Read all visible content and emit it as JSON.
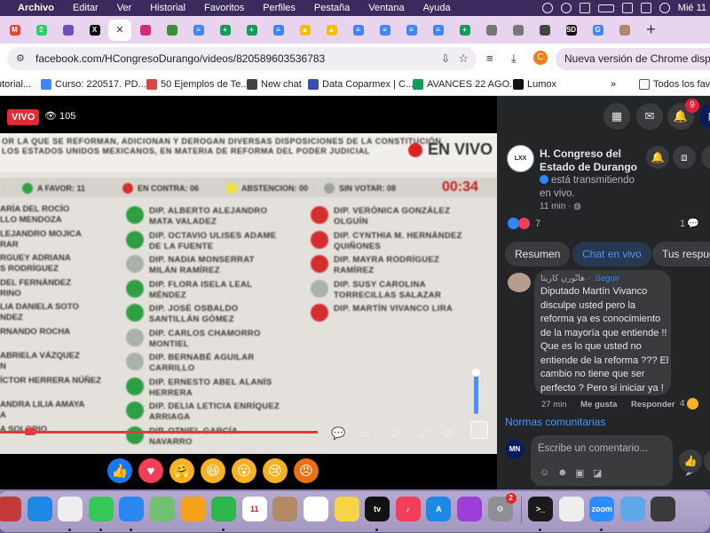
{
  "menubar": {
    "items": [
      "Archivo",
      "Editar",
      "Ver",
      "Historial",
      "Favoritos",
      "Perfiles",
      "Pestaña",
      "Ventana",
      "Ayuda"
    ],
    "clock": "Mié 11"
  },
  "tabs": [
    {
      "icon": "gmail-icon",
      "color": "#ea4335",
      "glyph": "M"
    },
    {
      "icon": "whatsapp-icon",
      "color": "#25d366",
      "glyph": "2"
    },
    {
      "icon": "extension-icon",
      "color": "#6b4fbb",
      "glyph": ""
    },
    {
      "icon": "x-icon",
      "color": "#000000",
      "glyph": "X"
    },
    {
      "icon": "close-tab-icon",
      "color": "#ffffff",
      "glyph": "✕"
    },
    {
      "icon": "instagram-icon",
      "color": "#d62976",
      "glyph": ""
    },
    {
      "icon": "globe-icon",
      "color": "#3c8d3c",
      "glyph": ""
    },
    {
      "icon": "docs-icon",
      "color": "#4285f4",
      "glyph": "≡"
    },
    {
      "icon": "sheets-icon",
      "color": "#0f9d58",
      "glyph": "+"
    },
    {
      "icon": "sheets-icon",
      "color": "#0f9d58",
      "glyph": "+"
    },
    {
      "icon": "docs-icon",
      "color": "#4285f4",
      "glyph": "≡"
    },
    {
      "icon": "drive-icon",
      "color": "#fbbc04",
      "glyph": "▲"
    },
    {
      "icon": "drive-icon",
      "color": "#fbbc04",
      "glyph": "▲"
    },
    {
      "icon": "docs-icon",
      "color": "#4285f4",
      "glyph": "≡"
    },
    {
      "icon": "docs-icon",
      "color": "#4285f4",
      "glyph": "≡"
    },
    {
      "icon": "docs-icon",
      "color": "#4285f4",
      "glyph": "≡"
    },
    {
      "icon": "docs-icon",
      "color": "#4285f4",
      "glyph": "≡"
    },
    {
      "icon": "sheets-icon",
      "color": "#0f9d58",
      "glyph": "+"
    },
    {
      "icon": "globe-icon",
      "color": "#777777",
      "glyph": ""
    },
    {
      "icon": "globe-icon",
      "color": "#777777",
      "glyph": ""
    },
    {
      "icon": "openai-icon",
      "color": "#444444",
      "glyph": ""
    },
    {
      "icon": "sd-icon",
      "color": "#111111",
      "glyph": "SD"
    },
    {
      "icon": "google-icon",
      "color": "#4285f4",
      "glyph": "G"
    },
    {
      "icon": "page-icon",
      "color": "#b08a6a",
      "glyph": ""
    },
    {
      "icon": "new-tab-icon",
      "color": "",
      "glyph": "+"
    }
  ],
  "omnibox": {
    "url": "facebook.com/HCongresoDurango/videos/820589603536783",
    "profile_initial": "C",
    "update_text": "Nueva versión de Chrome disponible"
  },
  "bookmarks": [
    {
      "label": "utorial...",
      "color": ""
    },
    {
      "label": "Curso: 220517. PD...",
      "color": "#4285f4"
    },
    {
      "label": "50 Ejemplos de Te...",
      "color": "#d44"
    },
    {
      "label": "New chat",
      "color": "#444"
    },
    {
      "label": "Data Coparmex | C...",
      "color": "#3b4db0"
    },
    {
      "label": "AVANCES 22 AGO...",
      "color": "#0f9d58"
    },
    {
      "label": "Lumox",
      "color": "#111"
    },
    {
      "label": "»",
      "color": ""
    },
    {
      "label": "Todos los favo",
      "color": ""
    }
  ],
  "video": {
    "live_badge": "VIVO",
    "viewers": "105",
    "header_line1": "OR LA QUE SE REFORMAN, ADICIONAN Y DEROGAN DIVERSAS DISPOSICIONES DE LA CONSTITUCIÓN",
    "header_line2": "LOS ESTADOS UNIDOS MEXICANOS, EN MATERIA DE REFORMA DEL PODER JUDICIAL",
    "en_vivo": "EN VIVO",
    "stats": [
      {
        "label": "A FAVOR: 11",
        "color": "#2ea043"
      },
      {
        "label": "EN CONTRA: 06",
        "color": "#d32f2f"
      },
      {
        "label": "ABSTENCION: 00",
        "color": "#e9e23a"
      },
      {
        "label": "SIN VOTAR: 08",
        "color": "#9aa39d"
      }
    ],
    "timer": "00:34",
    "left_names": [
      "ARÍA DEL ROCÍO\nLLO MENDOZA",
      "LEJANDRO MOJICA\nRAR",
      "RGUEY ADRIANA\nS RODRÍGUEZ",
      "DEL FERNÁNDEZ\nRINO",
      "LIA DANIELA SOTO\nNDEZ",
      "RNANDO ROCHA",
      "ABRIELA VÁZQUEZ\nN",
      "ÍCTOR HERRERA NÚÑEZ",
      "ANDRA LILIA AMAYA\nA",
      "A SOLORIO"
    ],
    "middle_votes": [
      {
        "name": "DIP. ALBERTO ALEJANDRO\nMATA VALADEZ",
        "color": "#2ea043"
      },
      {
        "name": "DIP. OCTAVIO ULISES ADAME\nDE LA FUENTE",
        "color": "#2ea043"
      },
      {
        "name": "DIP. NADIA MONSERRAT\nMILÁN RAMÍREZ",
        "color": "#a9b2ac"
      },
      {
        "name": "DIP. FLORA ISELA LEAL\nMÉNDEZ",
        "color": "#2ea043"
      },
      {
        "name": "DIP. JOSÉ OSBALDO\nSANTILLÁN GÓMEZ",
        "color": "#2ea043"
      },
      {
        "name": "DIP. CARLOS CHAMORRO\nMONTIEL",
        "color": "#a9b2ac"
      },
      {
        "name": "DIP. BERNABÉ AGUILAR\nCARRILLO",
        "color": "#a9b2ac"
      },
      {
        "name": "DIP. ERNESTO ABEL ALANÍS\nHERRERA",
        "color": "#2ea043"
      },
      {
        "name": "DIP. DELIA LETICIA ENRÍQUEZ\nARRIAGA",
        "color": "#2ea043"
      },
      {
        "name": "DIP. OTNIEL GARCÍA\nNAVARRO",
        "color": "#2ea043"
      }
    ],
    "right_votes": [
      {
        "name": "DIP. VERÓNICA GONZÁLEZ\nOLGUÍN",
        "color": "#d32f2f"
      },
      {
        "name": "DIP. CYNTHIA M. HERNÁNDEZ\nQUIÑONES",
        "color": "#d32f2f"
      },
      {
        "name": "DIP. MAYRA RODRÍGUEZ\nRAMÍREZ",
        "color": "#d32f2f"
      },
      {
        "name": "DIP. SUSY CAROLINA\nTORRECILLAS SALAZAR",
        "color": "#a9b2ac"
      },
      {
        "name": "DIP. MARTÍN VIVANCO LIRA",
        "color": "#d32f2f"
      }
    ],
    "progress_fraction": 0.64,
    "volume_fraction": 0.95
  },
  "reactions": [
    {
      "name": "like-reaction",
      "bg": "#1877f2",
      "glyph": "👍"
    },
    {
      "name": "love-reaction",
      "bg": "#f33e58",
      "glyph": "♥"
    },
    {
      "name": "care-reaction",
      "bg": "#f7b125",
      "glyph": "🤗"
    },
    {
      "name": "haha-reaction",
      "bg": "#f7b125",
      "glyph": "😆"
    },
    {
      "name": "wow-reaction",
      "bg": "#f7b125",
      "glyph": "😮"
    },
    {
      "name": "sad-reaction",
      "bg": "#f7b125",
      "glyph": "😢"
    },
    {
      "name": "angry-reaction",
      "bg": "#e9710f",
      "glyph": "😠"
    }
  ],
  "fb": {
    "notifications": "9",
    "page_name": "H. Congreso del Estado de Durango",
    "live_status": "está transmitiendo en vivo.",
    "time_ago": "11 min",
    "reaction_total": "7",
    "comment_total": "1",
    "tabs": [
      "Resumen",
      "Chat en vivo",
      "Tus respue"
    ],
    "comment": {
      "author": "هاتّورن كاريتا",
      "follow": "Seguir",
      "text": "Diputado Martín Vivanco disculpe usted pero la reforma ya es conocimiento de la mayoría que entiende !! Que es lo que usted no entiende de la reforma ??? El cambio no tiene que ser perfecto ? Pero si iniciar ya !",
      "age": "27 min",
      "like": "Me gusta",
      "reply": "Responder",
      "reaction_count": "4"
    },
    "community_link": "Normas comunitarias",
    "my_initials": "MN",
    "comment_placeholder": "Escribe un comentario..."
  },
  "dock": [
    {
      "name": "launchpad-icon",
      "bg": "#c23a3a",
      "glyph": ""
    },
    {
      "name": "safari-icon",
      "bg": "#1e88e5",
      "glyph": ""
    },
    {
      "name": "chrome-icon",
      "bg": "#eeeeee",
      "glyph": ""
    },
    {
      "name": "messages-icon",
      "bg": "#34c759",
      "glyph": ""
    },
    {
      "name": "mail-icon",
      "bg": "#2b86f0",
      "glyph": ""
    },
    {
      "name": "maps-icon",
      "bg": "#6fc16f",
      "glyph": ""
    },
    {
      "name": "photos-icon",
      "bg": "#f4a21b",
      "glyph": ""
    },
    {
      "name": "facetime-icon",
      "bg": "#2eb84b",
      "glyph": ""
    },
    {
      "name": "calendar-icon",
      "bg": "#ffffff",
      "glyph": "11"
    },
    {
      "name": "contacts-icon",
      "bg": "#b28a63",
      "glyph": ""
    },
    {
      "name": "reminders-icon",
      "bg": "#ffffff",
      "glyph": ""
    },
    {
      "name": "notes-icon",
      "bg": "#f5d547",
      "glyph": ""
    },
    {
      "name": "appletv-icon",
      "bg": "#111111",
      "glyph": "tv"
    },
    {
      "name": "music-icon",
      "bg": "#f33e58",
      "glyph": "♪"
    },
    {
      "name": "appstore-icon",
      "bg": "#1e88e5",
      "glyph": "A"
    },
    {
      "name": "podcasts-icon",
      "bg": "#9b3fd6",
      "glyph": ""
    },
    {
      "name": "settings-icon",
      "bg": "#8e8e93",
      "glyph": "⚙",
      "badge": "2"
    },
    {
      "name": "terminal-icon",
      "bg": "#1a1a1a",
      "glyph": ">_"
    },
    {
      "name": "textedit-icon",
      "bg": "#eeeeee",
      "glyph": ""
    },
    {
      "name": "zoom-icon",
      "bg": "#2d8cff",
      "glyph": "zoom"
    },
    {
      "name": "xcode-icon",
      "bg": "#5ea8e8",
      "glyph": ""
    },
    {
      "name": "quicktime-icon",
      "bg": "#3a3a3a",
      "glyph": ""
    }
  ]
}
